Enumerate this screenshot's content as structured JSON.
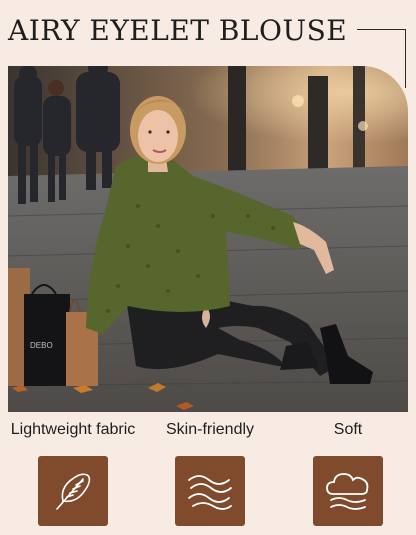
{
  "header": {
    "title": "AIRY EYELET BLOUSE"
  },
  "photo": {
    "bag_text": "DEBO"
  },
  "features": [
    {
      "label": "Lightweight fabric",
      "icon": "feather-icon"
    },
    {
      "label": "Skin-friendly",
      "icon": "waves-icon"
    },
    {
      "label": "Soft",
      "icon": "cloud-soft-icon"
    }
  ],
  "colors": {
    "background": "#f7ebe3",
    "icon_tile": "#7f4b2c",
    "blouse": "#56662c",
    "jeans": "#1f1f22"
  }
}
